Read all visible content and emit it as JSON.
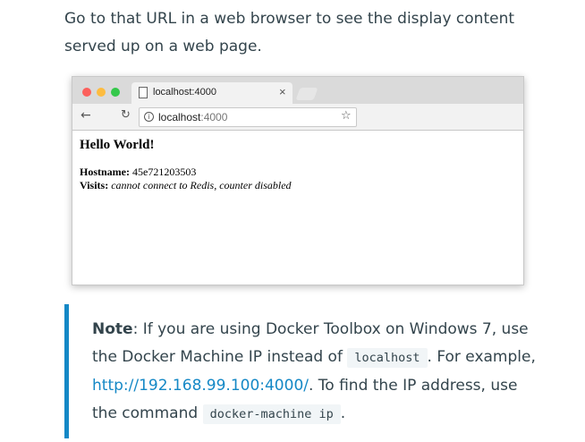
{
  "intro": {
    "text": "Go to that URL in a web browser to see the display content served up on a web page."
  },
  "browser": {
    "tab_title": "localhost:4000",
    "tab_close": "×",
    "url_host": "localhost",
    "url_port": ":4000",
    "page": {
      "heading": "Hello World!",
      "hostname_label": "Hostname:",
      "hostname_value": "45e721203503",
      "visits_label": "Visits:",
      "visits_value": "cannot connect to Redis, counter disabled"
    }
  },
  "note": {
    "label": "Note",
    "text_1": ": If you are using Docker Toolbox on Windows 7, use the Docker Machine IP instead of ",
    "code_1": "localhost",
    "text_2": ". For example, ",
    "link": "http://192.168.99.100:4000/",
    "text_3": ". To find the IP address, use the command ",
    "code_2": "docker-machine ip",
    "text_4": "."
  },
  "colors": {
    "accent": "#1488c6",
    "text": "#33444c"
  },
  "icons": [
    "page-icon",
    "close-icon",
    "back-arrow-icon",
    "reload-icon",
    "info-icon",
    "star-icon"
  ]
}
